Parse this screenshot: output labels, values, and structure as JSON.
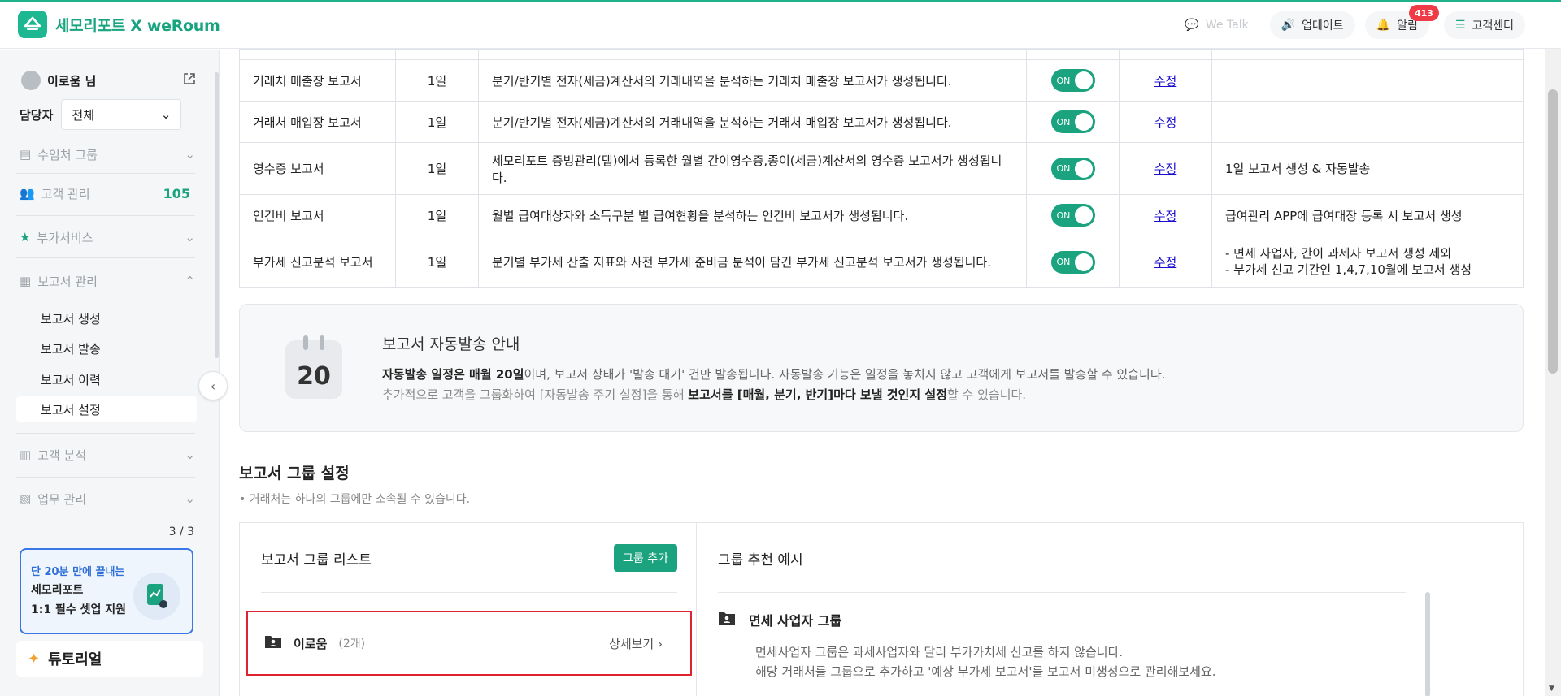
{
  "header": {
    "brand": "세모리포트 X weRoum",
    "we_talk": "We Talk",
    "update": "업데이트",
    "alarm": "알림",
    "alarm_count": "413",
    "support": "고객센터"
  },
  "sidebar": {
    "user_name": "이로움 님",
    "manager_label": "담당자",
    "manager_value": "전체",
    "items": [
      {
        "label": "수임처 그룹"
      },
      {
        "label": "고객 관리",
        "count": "105"
      },
      {
        "label": "부가서비스"
      },
      {
        "label": "보고서 관리"
      },
      {
        "label": "고객 분석"
      },
      {
        "label": "업무 관리"
      }
    ],
    "report_sub": [
      "보고서 생성",
      "보고서 발송",
      "보고서 이력",
      "보고서 설정"
    ],
    "active_sub": "보고서 설정",
    "pager": "3 / 3",
    "promo": {
      "line1": "단 20분 만에 끝내는",
      "line2": "세모리포트",
      "line3": "1:1 필수 셋업 지원"
    },
    "tutorial": "튜토리얼"
  },
  "report_table": {
    "rows": [
      {
        "name": "거래처 매출장 보고서",
        "day": "1일",
        "desc": "분기/반기별 전자(세금)계산서의 거래내역을 분석하는 거래처 매출장 보고서가 생성됩니다.",
        "toggle": "ON",
        "edit": "수정",
        "note": ""
      },
      {
        "name": "거래처 매입장 보고서",
        "day": "1일",
        "desc": "분기/반기별 전자(세금)계산서의 거래내역을 분석하는 거래처 매입장 보고서가 생성됩니다.",
        "toggle": "ON",
        "edit": "수정",
        "note": ""
      },
      {
        "name": "영수증 보고서",
        "day": "1일",
        "desc": "세모리포트 증빙관리(탭)에서 등록한 월별 간이영수증,종이(세금)계산서의 영수증 보고서가 생성됩니다.",
        "toggle": "ON",
        "edit": "수정",
        "note": "1일 보고서 생성 & 자동발송"
      },
      {
        "name": "인건비 보고서",
        "day": "1일",
        "desc": "월별 급여대상자와 소득구분 별 급여현황을 분석하는 인건비 보고서가 생성됩니다.",
        "toggle": "ON",
        "edit": "수정",
        "note": "급여관리 APP에 급여대장 등록 시 보고서 생성"
      },
      {
        "name": "부가세 신고분석 보고서",
        "day": "1일",
        "desc": "분기별 부가세 산출 지표와 사전 부가세 준비금 분석이 담긴 부가세 신고분석 보고서가 생성됩니다.",
        "toggle": "ON",
        "edit": "수정",
        "note": "- 면세 사업자, 간이 과세자 보고서 생성 제외\n- 부가세 신고 기간인 1,4,7,10월에 보고서 생성"
      }
    ]
  },
  "notice": {
    "calendar_day": "20",
    "title": "보고서 자동발송 안내",
    "line1_bold": "자동발송 일정은 매월 20일",
    "line1_rest": "이며, 보고서 상태가 '발송 대기' 건만 발송됩니다. 자동발송 기능은 일정을 놓치지 않고 고객에게 보고서를 발송할 수 있습니다.",
    "line2_start": "추가적으로 고객을 그룹화하여 [자동발송 주기 설정]을 통해 ",
    "line2_bold": "보고서를 [매월, 분기, 반기]마다 보낼 것인지 설정",
    "line2_end": "할 수 있습니다."
  },
  "group_settings": {
    "title": "보고서 그룹 설정",
    "subtitle": "• 거래처는 하나의 그룹에만 소속될 수 있습니다.",
    "list_title": "보고서 그룹 리스트",
    "add_button": "그룹 추가",
    "group_name": "이로움",
    "group_count": "(2개)",
    "detail_link": "상세보기",
    "example_title": "그룹 추천 예시",
    "example_name": "면세 사업자 그룹",
    "example_line1": "면세사업자 그룹은 과세사업자와 달리 부가가치세 신고를 하지 않습니다.",
    "example_line2": "해당 거래처를 그룹으로 추가하고 '예상 부가세 보고서'를 보고서 미생성으로 관리해보세요."
  },
  "colors": {
    "accent": "#1aa37e",
    "link": "#1a0dcc",
    "alert": "#ef3b45"
  }
}
